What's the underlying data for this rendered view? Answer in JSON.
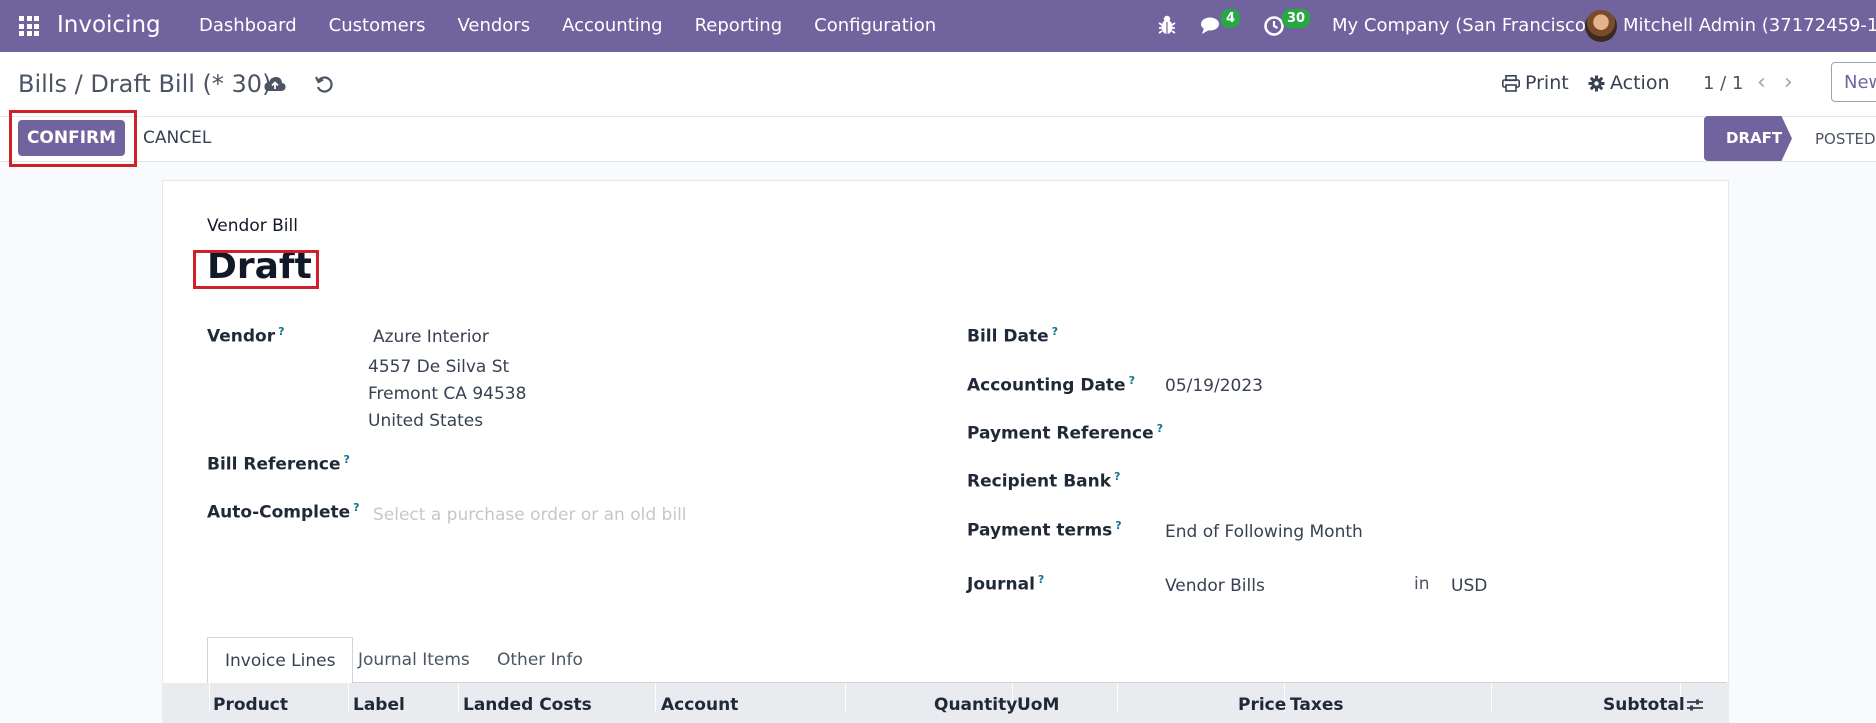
{
  "navbar": {
    "app_name": "Invoicing",
    "menu": [
      "Dashboard",
      "Customers",
      "Vendors",
      "Accounting",
      "Reporting",
      "Configuration"
    ],
    "icons": {
      "apps": "apps-grid-icon",
      "debug": "bug-icon",
      "messages": "chat-icon",
      "activities": "clock-icon"
    },
    "messages_badge": "4",
    "activities_badge": "30",
    "company": "My Company (San Francisco)",
    "user": "Mitchell Admin (37172459-16-0"
  },
  "control_panel": {
    "breadcrumb": "Bills / Draft Bill (* 30)",
    "print_label": "Print",
    "action_label": "Action",
    "pager": "1 / 1",
    "new_label": "New"
  },
  "statusbar": {
    "confirm_label": "CONFIRM",
    "cancel_label": "CANCEL",
    "stages": [
      "DRAFT",
      "POSTED"
    ],
    "current_stage": "DRAFT"
  },
  "form": {
    "doc_type": "Vendor Bill",
    "title": "Draft",
    "left": {
      "vendor_label": "Vendor",
      "vendor_name": "Azure Interior",
      "vendor_address": [
        "4557 De Silva St",
        "Fremont CA 94538",
        "United States"
      ],
      "bill_reference_label": "Bill Reference",
      "auto_complete_label": "Auto-Complete",
      "auto_complete_placeholder": "Select a purchase order or an old bill"
    },
    "right": {
      "bill_date_label": "Bill Date",
      "accounting_date_label": "Accounting Date",
      "accounting_date": "05/19/2023",
      "payment_reference_label": "Payment Reference",
      "recipient_bank_label": "Recipient Bank",
      "payment_terms_label": "Payment terms",
      "payment_terms": "End of Following Month",
      "journal_label": "Journal",
      "journal": "Vendor Bills",
      "in_label": "in",
      "currency": "USD"
    },
    "help_mark": "?"
  },
  "tabs": [
    "Invoice Lines",
    "Journal Items",
    "Other Info"
  ],
  "columns": [
    "Product",
    "Label",
    "Landed Costs",
    "Account",
    "Quantity",
    "UoM",
    "Price",
    "Taxes",
    "Subtotal"
  ],
  "colors": {
    "navbar": "#71639e",
    "accent": "#71639e",
    "badge": "#28a745",
    "highlight": "#d0202a"
  }
}
